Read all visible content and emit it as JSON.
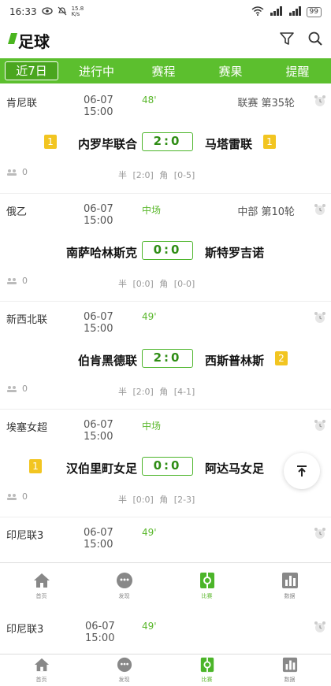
{
  "status_bar": {
    "time": "16:33",
    "net_speed": "15.8 K/s",
    "battery": "99"
  },
  "header": {
    "title": "足球"
  },
  "tabs": [
    {
      "label": "近7日",
      "active": true
    },
    {
      "label": "进行中",
      "active": false
    },
    {
      "label": "赛程",
      "active": false
    },
    {
      "label": "赛果",
      "active": false
    },
    {
      "label": "提醒",
      "active": false
    }
  ],
  "matches": [
    {
      "league": "肯尼联",
      "date": "06-07",
      "time": "15:00",
      "status": "48'",
      "round": "联赛 第35轮",
      "home": "内罗毕联合",
      "score": "2:0",
      "away": "马塔雷联",
      "home_card": "1",
      "away_card": "1",
      "count": "0",
      "half": "半 [2:0]",
      "corner": "角 [0-5]"
    },
    {
      "league": "俄乙",
      "date": "06-07",
      "time": "15:00",
      "status": "中场",
      "round": "中部 第10轮",
      "home": "南萨哈林斯克",
      "score": "0:0",
      "away": "斯特罗吉诺",
      "home_card": "",
      "away_card": "",
      "count": "0",
      "half": "半 [0:0]",
      "corner": "角 [0-0]"
    },
    {
      "league": "新西北联",
      "date": "06-07",
      "time": "15:00",
      "status": "49'",
      "round": "",
      "home": "伯肯黑德联",
      "score": "2:0",
      "away": "西斯普林斯",
      "home_card": "",
      "away_card": "2",
      "count": "0",
      "half": "半 [2:0]",
      "corner": "角 [4-1]"
    },
    {
      "league": "埃塞女超",
      "date": "06-07",
      "time": "15:00",
      "status": "中场",
      "round": "",
      "home": "汉伯里町女足",
      "score": "0:0",
      "away": "阿达马女足",
      "home_card": "1",
      "away_card": "",
      "count": "0",
      "half": "半 [0:0]",
      "corner": "角 [2-3]"
    },
    {
      "league": "印尼联3",
      "date": "06-07",
      "time": "15:00",
      "status": "49'",
      "round": ""
    },
    {
      "league": "印尼联3",
      "date": "06-07",
      "time": "15:00",
      "status": "49'",
      "round": ""
    }
  ],
  "bottom_nav": [
    {
      "label": "首页",
      "icon": "home-icon"
    },
    {
      "label": "发现",
      "icon": "chat-icon"
    },
    {
      "label": "比赛",
      "icon": "match-icon",
      "active": true
    },
    {
      "label": "数据",
      "icon": "chart-icon"
    }
  ],
  "colors": {
    "accent": "#5cbf2e",
    "card": "#f2c521"
  }
}
